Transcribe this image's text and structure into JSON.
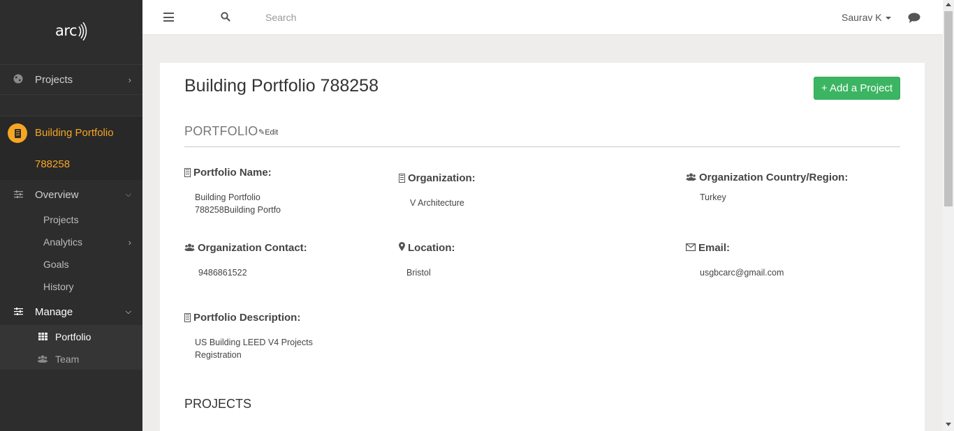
{
  "app": {
    "logo": "arc"
  },
  "sidebar": {
    "projects_label": "Projects",
    "portfolio_title": "Building Portfolio",
    "portfolio_number": "788258",
    "overview_label": "Overview",
    "overview_items": [
      "Projects",
      "Analytics",
      "Goals",
      "History"
    ],
    "manage_label": "Manage",
    "manage_items": [
      "Portfolio",
      "Team"
    ]
  },
  "topbar": {
    "search_placeholder": "Search",
    "user_name": "Saurav K"
  },
  "page": {
    "title": "Building Portfolio 788258",
    "add_button": "+ Add a Project",
    "section_portfolio": "PORTFOLIO",
    "edit_label": "Edit",
    "section_projects": "PROJECTS"
  },
  "fields": {
    "portfolio_name_label": "Portfolio Name:",
    "portfolio_name_value_line1": "Building Portfolio",
    "portfolio_name_value_line2": "788258Building Portfo",
    "organization_label": "Organization:",
    "organization_value": "V Architecture",
    "country_label": "Organization Country/Region:",
    "country_value": "Turkey",
    "contact_label": "Organization Contact:",
    "contact_value": "9486861522",
    "location_label": "Location:",
    "location_value": "Bristol",
    "email_label": "Email:",
    "email_value": "usgbcarc@gmail.com",
    "description_label": "Portfolio Description:",
    "description_value_line1": "US Building LEED V4 Projects",
    "description_value_line2": "Registration"
  },
  "colors": {
    "sidebar_bg": "#2d2d2d",
    "accent_orange": "#f5a623",
    "button_green": "#3cb562"
  }
}
